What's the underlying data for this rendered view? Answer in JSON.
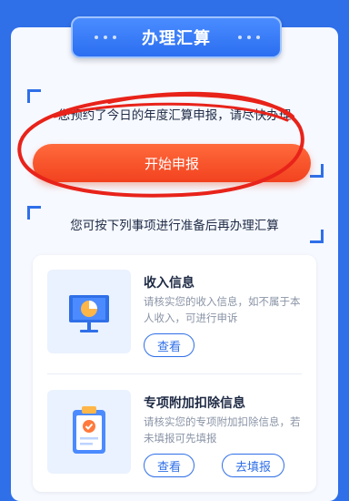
{
  "header": {
    "title": "办理汇算"
  },
  "notice": {
    "top": "您预约了今日的年度汇算申报，请尽快办理",
    "bottom": "您可按下列事项进行准备后再办理汇算"
  },
  "start_button": {
    "label": "开始申报"
  },
  "items": [
    {
      "title": "收入信息",
      "desc": "请核实您的收入信息，如不属于本人收入，可进行申诉",
      "buttons": [
        "查看"
      ]
    },
    {
      "title": "专项附加扣除信息",
      "desc": "请核实您的专项附加扣除信息，若未填报可先填报",
      "buttons": [
        "查看",
        "去填报"
      ]
    }
  ],
  "colors": {
    "brand": "#2f6fe8",
    "accent": "#f2421f",
    "scribble": "#e8231a"
  },
  "icons": [
    "presentation-chart-icon",
    "clipboard-check-icon"
  ]
}
